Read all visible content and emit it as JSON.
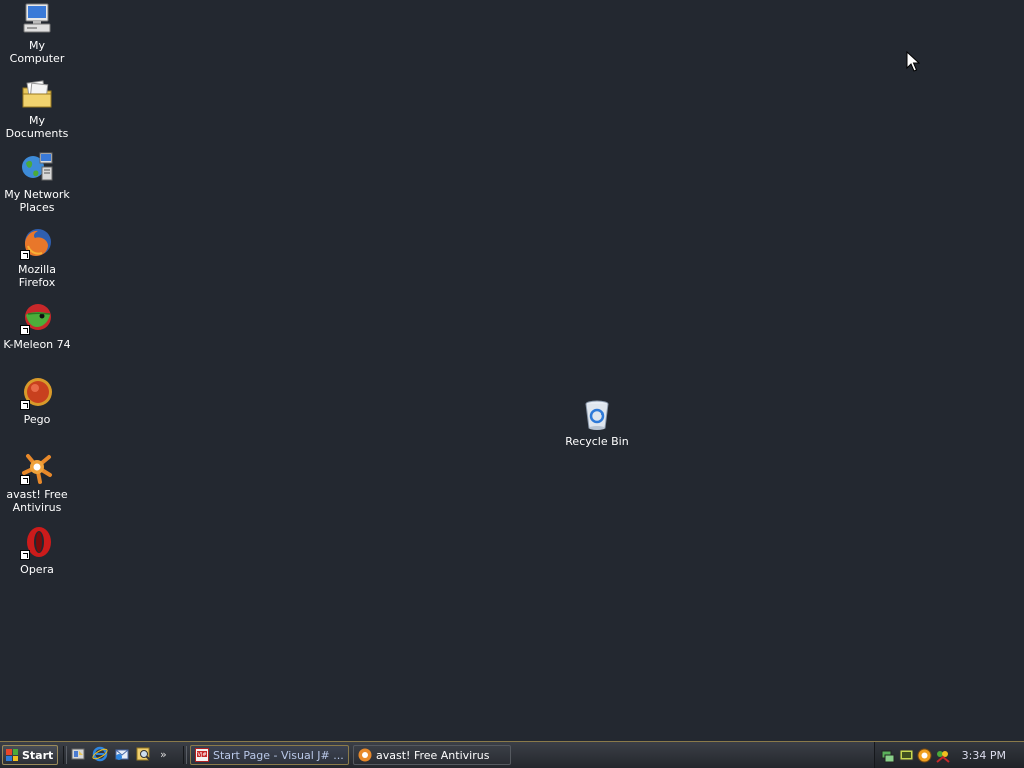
{
  "desktop": {
    "background_color": "#232830",
    "icons": [
      {
        "label": "My Computer",
        "icon": "computer-icon"
      },
      {
        "label": "My Documents",
        "icon": "documents-folder-icon"
      },
      {
        "label": "My Network Places",
        "icon": "network-places-icon"
      },
      {
        "label": "Mozilla Firefox",
        "icon": "firefox-icon"
      },
      {
        "label": "K-Meleon 74",
        "icon": "kmeleon-icon"
      },
      {
        "label": "Pego",
        "icon": "pego-icon"
      },
      {
        "label": "avast! Free Antivirus",
        "icon": "avast-icon"
      },
      {
        "label": "Opera",
        "icon": "opera-icon"
      },
      {
        "label": "Recycle Bin",
        "icon": "recycle-bin-icon"
      }
    ]
  },
  "taskbar": {
    "start_label": "Start",
    "quicklaunch": [
      "show-desktop-icon",
      "internet-explorer-icon",
      "outlook-express-icon",
      "search-icon"
    ],
    "quicklaunch_more": "»",
    "tasks": [
      {
        "label": "Start Page - Visual J# ...",
        "icon": "visual-studio-icon",
        "active": true
      },
      {
        "label": "avast! Free Antivirus",
        "icon": "avast-icon",
        "active": false
      }
    ],
    "tray_icons": [
      "network-tray-icon",
      "monitor-tray-icon",
      "avast-tray-icon",
      "messenger-tray-icon"
    ],
    "clock": "3:34 PM"
  }
}
